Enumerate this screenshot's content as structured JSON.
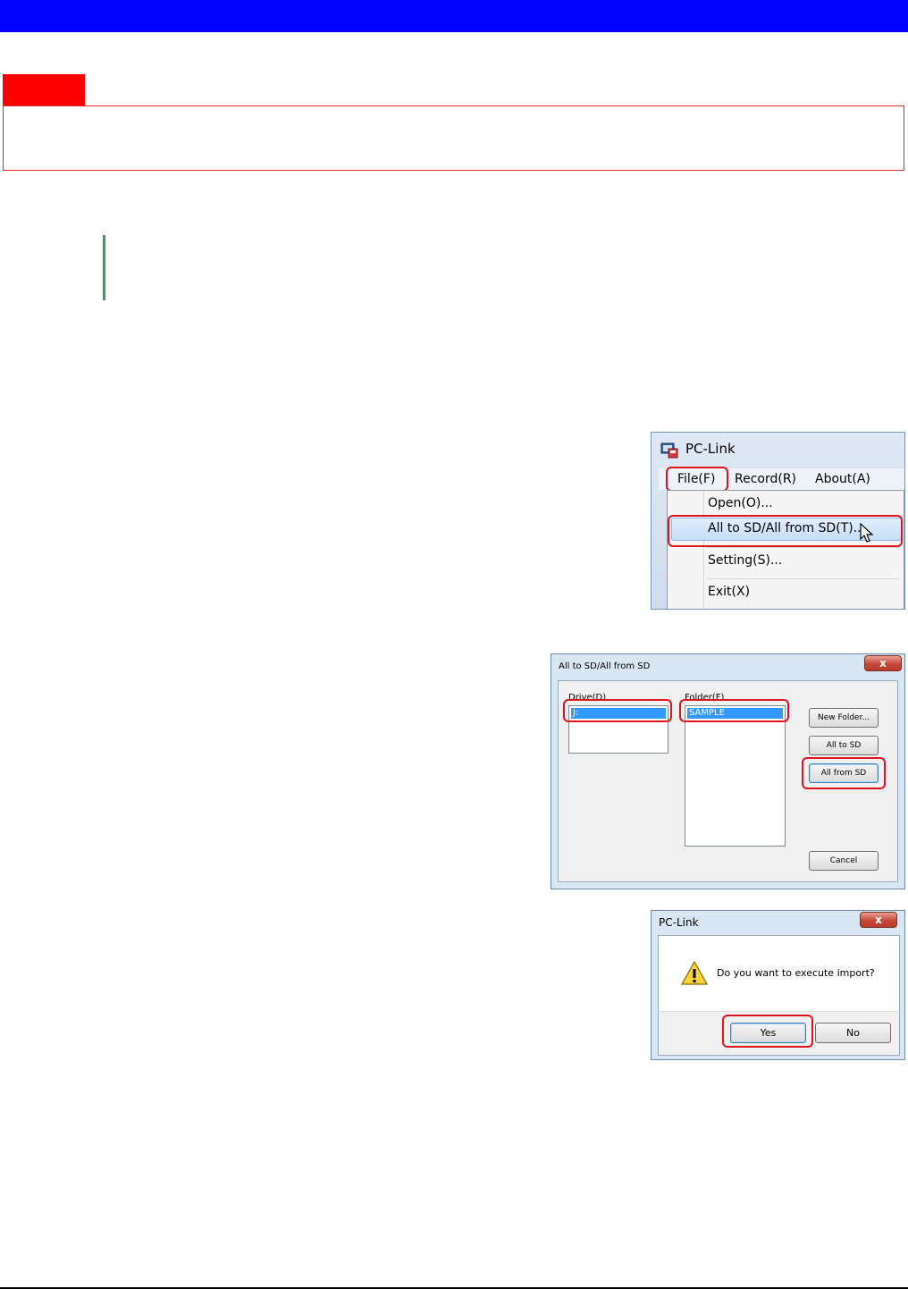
{
  "menu_window": {
    "title": "PC-Link",
    "menubar": [
      "File(F)",
      "Record(R)",
      "About(A)"
    ],
    "dropdown": [
      "Open(O)...",
      "All to SD/All from SD(T)...",
      "Setting(S)...",
      "Exit(X)"
    ],
    "highlighted_item": "All to SD/All from SD(T)..."
  },
  "sd_dialog": {
    "title": "All to SD/All from SD",
    "close_label": "x",
    "drive_label": "Drive(D)",
    "drive_selected": "J:",
    "folder_label": "Folder(F)",
    "folder_selected": "SAMPLE",
    "buttons": {
      "new_folder": "New Folder...",
      "all_to_sd": "All to SD",
      "all_from_sd": "All from SD",
      "cancel": "Cancel"
    }
  },
  "confirm_dialog": {
    "title": "PC-Link",
    "close_label": "x",
    "message": "Do you want to execute import?",
    "yes": "Yes",
    "no": "No"
  },
  "colors": {
    "header_blue": "#0000ff",
    "note_red": "#ff0000",
    "highlight_red": "#e0141e",
    "accent_green": "#3d9a6a"
  }
}
